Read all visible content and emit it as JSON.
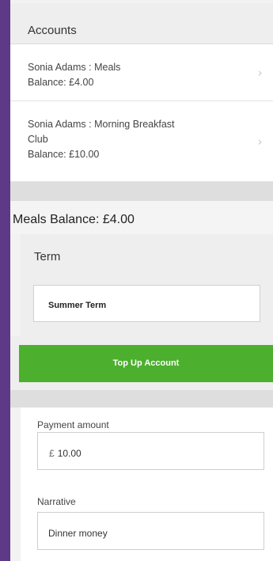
{
  "accounts": {
    "title": "Accounts",
    "items": [
      {
        "name": "Sonia Adams : Meals",
        "balance": "Balance: £4.00"
      },
      {
        "name_line1": "Sonia Adams : Morning Breakfast",
        "name_line2": "Club",
        "balance": "Balance: £10.00"
      }
    ]
  },
  "meals": {
    "title": "Meals Balance: £4.00",
    "term_label": "Term",
    "term_value": "Summer Term",
    "topup_label": "Top Up Account"
  },
  "payment": {
    "amount_label": "Payment amount",
    "currency": "£",
    "amount_value": "10.00",
    "narrative_label": "Narrative",
    "narrative_value": "Dinner money"
  },
  "colors": {
    "brand_purple": "#5e3a86",
    "topup_green": "#4caf2e"
  }
}
